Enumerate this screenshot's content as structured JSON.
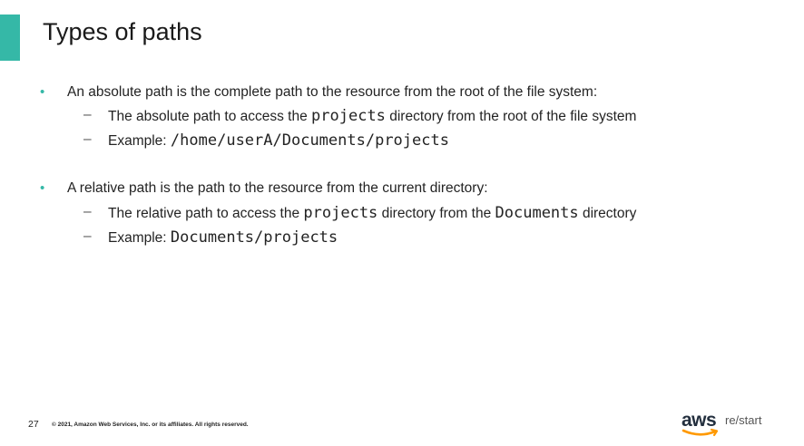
{
  "slide": {
    "title": "Types of paths",
    "page_number": "27",
    "copyright": "© 2021, Amazon Web Services, Inc. or its affiliates. All rights reserved.",
    "accent_color": "#35b8a7"
  },
  "bullets": [
    {
      "text": "An absolute path is the complete path to the resource from the root of the file system:",
      "sub": [
        {
          "pre": "The absolute path to access the ",
          "code": "projects",
          "mid": " directory from the root of the file system",
          "code2": "",
          "post": ""
        },
        {
          "pre": "Example: ",
          "code": "/home/userA/Documents/projects",
          "mid": "",
          "code2": "",
          "post": ""
        }
      ]
    },
    {
      "text": "A relative path is the path to the resource from the current directory:",
      "sub": [
        {
          "pre": "The relative path to access the ",
          "code": "projects",
          "mid": " directory from the ",
          "code2": "Documents",
          "post": " directory"
        },
        {
          "pre": "Example: ",
          "code": "Documents/projects",
          "mid": "",
          "code2": "",
          "post": ""
        }
      ]
    }
  ],
  "logo": {
    "brand": "aws",
    "product": "re/start",
    "icon": "aws-smile-icon"
  }
}
